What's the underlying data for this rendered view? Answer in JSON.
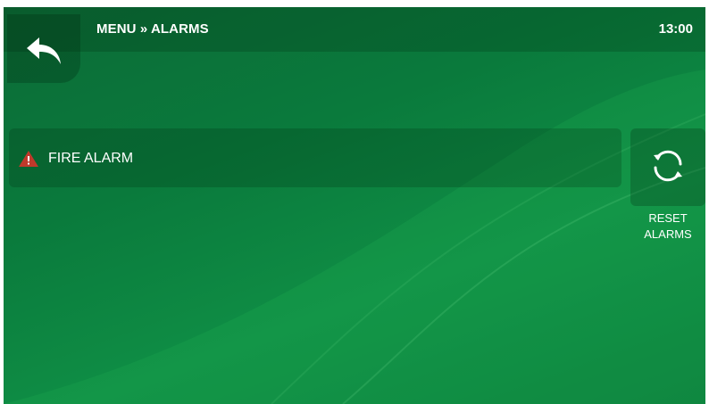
{
  "header": {
    "breadcrumb": "MENU » ALARMS",
    "time": "13:00"
  },
  "alarms": [
    {
      "label": "FIRE ALARM",
      "icon": "warning-triangle-icon",
      "color": "#c0392b"
    }
  ],
  "reset": {
    "label_line1": "RESET",
    "label_line2": "ALARMS",
    "icon": "refresh-icon"
  },
  "colors": {
    "background": "#0b7a3c",
    "text": "#ffffff",
    "alert": "#c0392b"
  }
}
